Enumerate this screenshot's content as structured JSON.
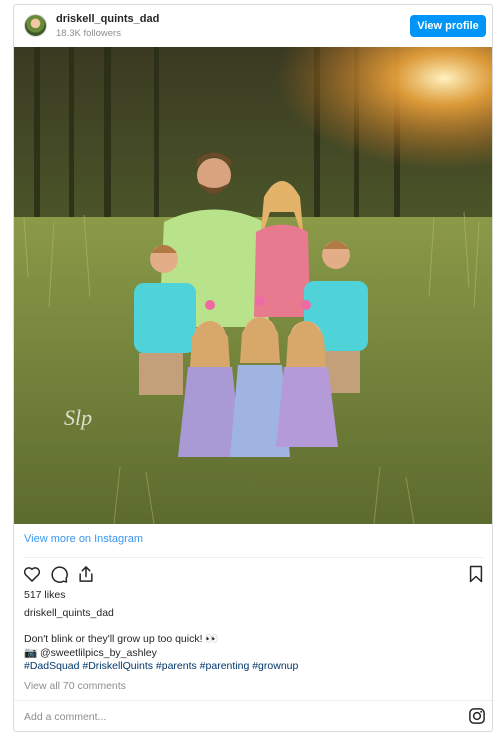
{
  "header": {
    "username": "driskell_quints_dad",
    "followers": "18.3K followers",
    "view_profile_label": "View profile"
  },
  "photo": {
    "subject": "family-portrait",
    "watermark": "Sweet Lil Pics by Ashley"
  },
  "view_more_label": "View more on Instagram",
  "actions": {
    "icons": [
      "heart-icon",
      "comment-icon",
      "share-icon",
      "bookmark-icon"
    ]
  },
  "likes": "517 likes",
  "post_username": "driskell_quints_dad",
  "caption": {
    "line1": "Don't blink or they'll grow up too quick! 👀",
    "line2": "📷 @sweetlilpics_by_ashley",
    "line3": "#DadSquad #DriskellQuints #parents #parenting #grownup"
  },
  "view_comments_label": "View all 70 comments",
  "comment_placeholder": "Add a comment...",
  "colors": {
    "accent": "#0095f6",
    "link": "#3897f0",
    "hashtag": "#00376b"
  }
}
